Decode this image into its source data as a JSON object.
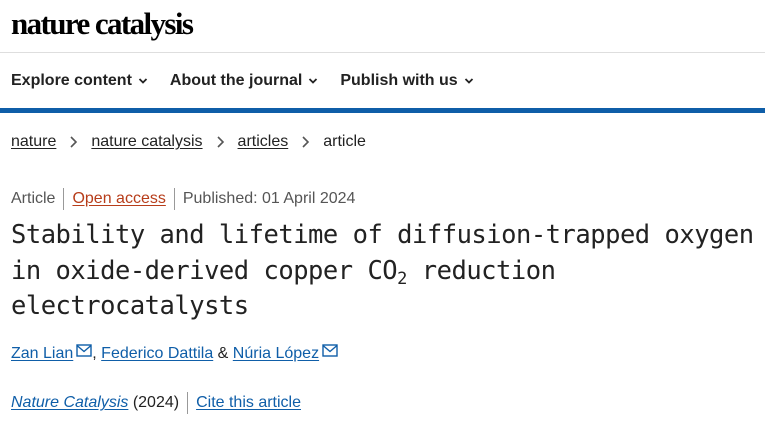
{
  "header": {
    "logo_text": "nature catalysis"
  },
  "nav": {
    "items": [
      {
        "label": "Explore content"
      },
      {
        "label": "About the journal"
      },
      {
        "label": "Publish with us"
      }
    ]
  },
  "breadcrumb": {
    "items": [
      "nature",
      "nature catalysis",
      "articles"
    ],
    "current": "article"
  },
  "meta": {
    "type": "Article",
    "access": "Open access",
    "published": "Published: 01 April 2024"
  },
  "article": {
    "title_part1": "Stability and lifetime of diffusion-trapped oxygen in oxide-derived copper CO",
    "title_sub": "2",
    "title_part2": " reduction electrocatalysts"
  },
  "authors": {
    "list": [
      "Zan Lian",
      "Federico Dattila",
      "Núria López"
    ],
    "sep_comma": ",",
    "sep_and": "&"
  },
  "citation": {
    "journal": "Nature Catalysis",
    "year": "(2024)",
    "cite_label": "Cite this article"
  },
  "colors": {
    "accent": "#0f5ea8",
    "open_access": "#b73d1a",
    "text": "#222222"
  }
}
